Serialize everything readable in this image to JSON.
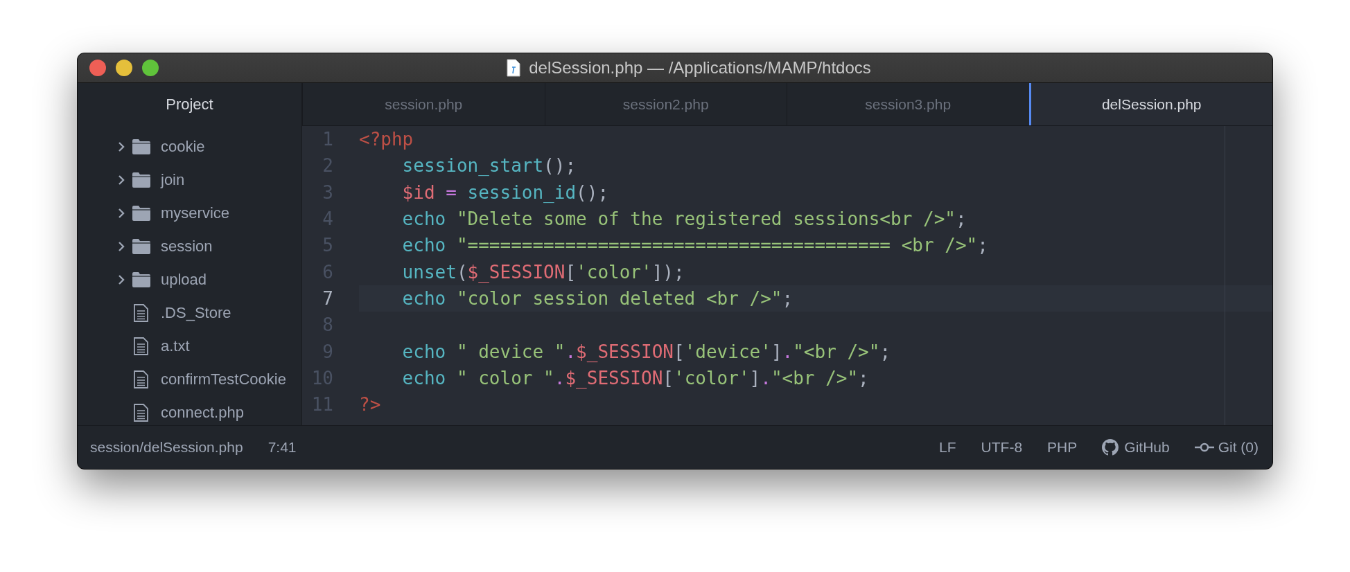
{
  "window": {
    "title": "delSession.php — /Applications/MAMP/htdocs"
  },
  "sidebar": {
    "title": "Project",
    "items": [
      {
        "kind": "folder",
        "name": "cookie"
      },
      {
        "kind": "folder",
        "name": "join"
      },
      {
        "kind": "folder",
        "name": "myservice"
      },
      {
        "kind": "folder",
        "name": "session"
      },
      {
        "kind": "folder",
        "name": "upload"
      },
      {
        "kind": "file",
        "name": ".DS_Store"
      },
      {
        "kind": "file",
        "name": "a.txt"
      },
      {
        "kind": "file",
        "name": "confirmTestCookie"
      },
      {
        "kind": "file",
        "name": "connect.php"
      }
    ]
  },
  "tabs": [
    {
      "label": "session.php",
      "selected": false
    },
    {
      "label": "session2.php",
      "selected": false
    },
    {
      "label": "session3.php",
      "selected": false
    },
    {
      "label": "delSession.php",
      "selected": true
    }
  ],
  "editor": {
    "lines": [
      {
        "number": "1",
        "active": false,
        "tokens": [
          {
            "kind": "tag",
            "text": "<?php"
          }
        ]
      },
      {
        "number": "2",
        "active": false,
        "tokens": [
          {
            "kind": "func",
            "text": "    session_start"
          },
          {
            "kind": "punct",
            "text": "();"
          }
        ]
      },
      {
        "number": "3",
        "active": false,
        "tokens": [
          {
            "kind": "var",
            "text": "    $id "
          },
          {
            "kind": "op",
            "text": "="
          },
          {
            "kind": "func",
            "text": " session_id"
          },
          {
            "kind": "punct",
            "text": "();"
          }
        ]
      },
      {
        "number": "4",
        "active": false,
        "tokens": [
          {
            "kind": "func",
            "text": "    echo "
          },
          {
            "kind": "string",
            "text": "\"Delete some of the registered sessions<br />\""
          },
          {
            "kind": "punct",
            "text": ";"
          }
        ]
      },
      {
        "number": "5",
        "active": false,
        "tokens": [
          {
            "kind": "func",
            "text": "    echo "
          },
          {
            "kind": "string",
            "text": "\"======================================= <br />\""
          },
          {
            "kind": "punct",
            "text": ";"
          }
        ]
      },
      {
        "number": "6",
        "active": false,
        "tokens": [
          {
            "kind": "func",
            "text": "    unset"
          },
          {
            "kind": "punct",
            "text": "("
          },
          {
            "kind": "var",
            "text": "$_SESSION"
          },
          {
            "kind": "punct",
            "text": "["
          },
          {
            "kind": "string",
            "text": "'color'"
          },
          {
            "kind": "punct",
            "text": "]);"
          }
        ]
      },
      {
        "number": "7",
        "active": true,
        "tokens": [
          {
            "kind": "func",
            "text": "    echo "
          },
          {
            "kind": "string",
            "text": "\"color session deleted <br />\""
          },
          {
            "kind": "punct",
            "text": ";"
          }
        ]
      },
      {
        "number": "8",
        "active": false
      },
      {
        "number": "9",
        "active": false,
        "tokens": [
          {
            "kind": "func",
            "text": "    echo "
          },
          {
            "kind": "string",
            "text": "\" device \""
          },
          {
            "kind": "op",
            "text": "."
          },
          {
            "kind": "var",
            "text": "$_SESSION"
          },
          {
            "kind": "punct",
            "text": "["
          },
          {
            "kind": "string",
            "text": "'device'"
          },
          {
            "kind": "punct",
            "text": "]"
          },
          {
            "kind": "op",
            "text": "."
          },
          {
            "kind": "string",
            "text": "\"<br />\""
          },
          {
            "kind": "punct",
            "text": ";"
          }
        ]
      },
      {
        "number": "10",
        "active": false,
        "tokens": [
          {
            "kind": "func",
            "text": "    echo "
          },
          {
            "kind": "string",
            "text": "\" color \""
          },
          {
            "kind": "op",
            "text": "."
          },
          {
            "kind": "var",
            "text": "$_SESSION"
          },
          {
            "kind": "punct",
            "text": "["
          },
          {
            "kind": "string",
            "text": "'color'"
          },
          {
            "kind": "punct",
            "text": "]"
          },
          {
            "kind": "op",
            "text": "."
          },
          {
            "kind": "string",
            "text": "\"<br />\""
          },
          {
            "kind": "punct",
            "text": ";"
          }
        ]
      },
      {
        "number": "11",
        "active": false,
        "tokens": [
          {
            "kind": "tag",
            "text": "?>"
          }
        ]
      }
    ]
  },
  "status_bar": {
    "path": "session/delSession.php",
    "cursor": "7:41",
    "line_ending": "LF",
    "encoding": "UTF-8",
    "grammar": "PHP",
    "github": "GitHub",
    "git": "Git (0)"
  }
}
